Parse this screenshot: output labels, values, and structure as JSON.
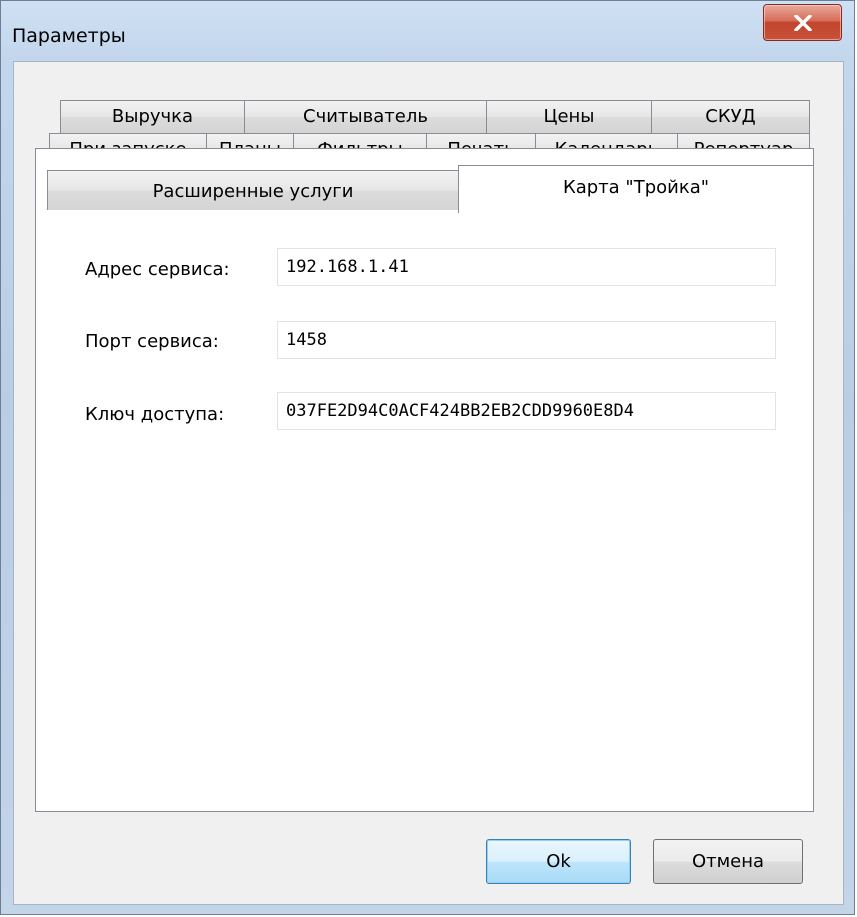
{
  "window": {
    "title": "Параметры"
  },
  "tabs": {
    "row1": [
      "Выручка",
      "Считыватель",
      "Цены",
      "СКУД"
    ],
    "row2": [
      "При запуске",
      "Планы",
      "Фильтры",
      "Печать",
      "Календарь",
      "Репертуар"
    ],
    "row3": [
      "Расширенные услуги",
      "Карта \"Тройка\""
    ],
    "active": "Карта \"Тройка\""
  },
  "form": {
    "service_address_label": "Адрес сервиса:",
    "service_address_value": "192.168.1.41",
    "service_port_label": "Порт сервиса:",
    "service_port_value": "1458",
    "access_key_label": "Ключ доступа:",
    "access_key_value": "037FE2D94C0ACF424BB2EB2CDD9960E8D4"
  },
  "buttons": {
    "ok": "Ok",
    "cancel": "Отмена"
  },
  "icons": {
    "close": "close-icon"
  },
  "colors": {
    "close_button": "#c9523a",
    "default_button_border": "#3c7fb1",
    "window_frame": "#bed2e8"
  }
}
